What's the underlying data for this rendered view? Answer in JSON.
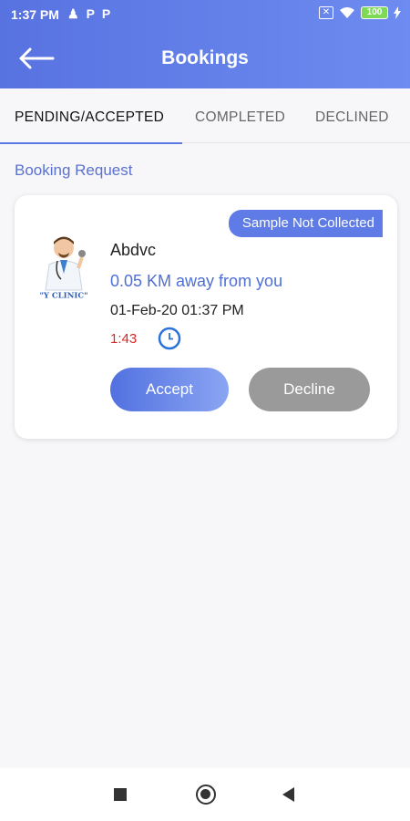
{
  "status_bar": {
    "time": "1:37 PM",
    "left_icons": [
      "♟",
      "P",
      "P"
    ],
    "battery": "100"
  },
  "header": {
    "title": "Bookings"
  },
  "tabs": [
    {
      "label": "PENDING/ACCEPTED",
      "active": true
    },
    {
      "label": "COMPLETED",
      "active": false
    },
    {
      "label": "DECLINED",
      "active": false
    }
  ],
  "section": {
    "title": "Booking Request"
  },
  "booking": {
    "status": "Sample Not Collected",
    "name": "Abdvc",
    "distance": "0.05 KM away from you",
    "datetime": "01-Feb-20 01:37 PM",
    "timer": "1:43",
    "avatar_caption": "\"Y CLINIC\"",
    "accept_label": "Accept",
    "decline_label": "Decline"
  },
  "colors": {
    "accent": "#5b77e3",
    "timer": "#d82828",
    "decline": "#9a9a9a"
  }
}
